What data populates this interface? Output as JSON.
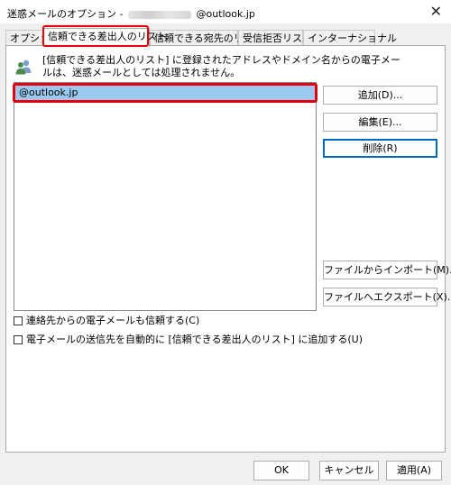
{
  "window": {
    "title_prefix": "迷惑メールのオプション -",
    "title_suffix": "@outlook.jp",
    "close_symbol": "✕"
  },
  "tabs": [
    {
      "label": "オプション"
    },
    {
      "label": "信頼できる差出人のリスト"
    },
    {
      "label": "信頼できる宛先のリスト"
    },
    {
      "label": "受信拒否リスト"
    },
    {
      "label": "インターナショナル"
    }
  ],
  "active_tab_index": 1,
  "info": {
    "icon": "people-icon",
    "text": "[信頼できる差出人のリスト] に登録されたアドレスやドメイン名からの電子メールは、迷惑メールとしては処理されません。"
  },
  "list": {
    "items": [
      "@outlook.jp"
    ],
    "selected_index": 0
  },
  "buttons": {
    "add": "追加(D)...",
    "edit": "編集(E)...",
    "delete": "削除(R)",
    "import": "ファイルからインポート(M)...",
    "export": "ファイルへエクスポート(X)..."
  },
  "checkboxes": {
    "trust_contacts": {
      "label": "連絡先からの電子メールも信頼する(C)",
      "checked": false
    },
    "auto_add_recipients": {
      "label": "電子メールの送信先を自動的に [信頼できる差出人のリスト] に追加する(U)",
      "checked": false
    }
  },
  "footer": {
    "ok": "OK",
    "cancel": "キャンセル",
    "apply": "適用(A)"
  },
  "colors": {
    "highlight": "#e3000b",
    "selection": "#9bc9f0",
    "focus_border": "#0067c0"
  }
}
